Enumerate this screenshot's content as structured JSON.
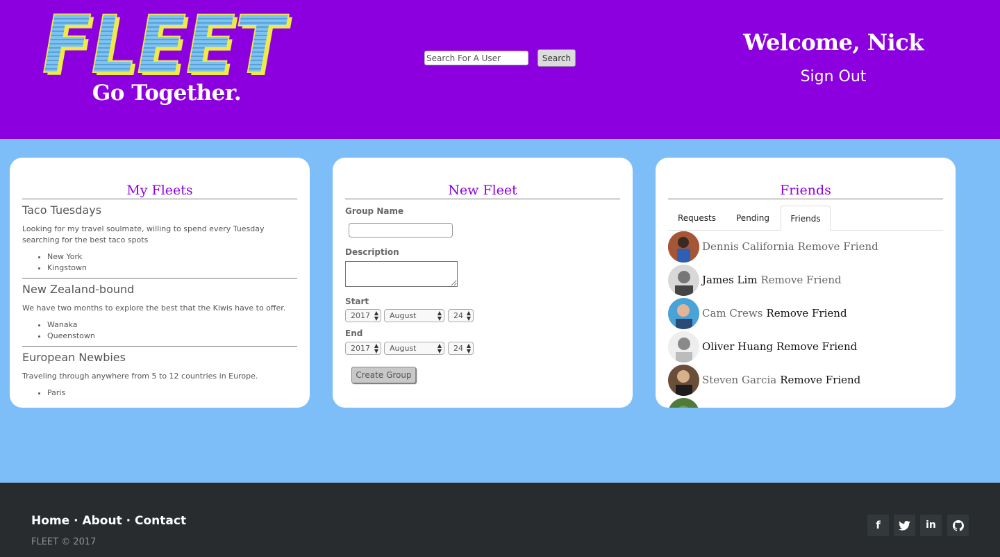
{
  "header": {
    "logo_text": "FLEET",
    "tagline": "Go Together.",
    "search": {
      "placeholder": "Search For A User",
      "button_label": "Search"
    },
    "welcome": "Welcome, Nick",
    "sign_out": "Sign Out"
  },
  "my_fleets": {
    "title": "My Fleets",
    "items": [
      {
        "name": "Taco Tuesdays",
        "description": "Looking for my travel soulmate, willing to spend every Tuesday searching for the best taco spots",
        "cities": [
          "New York",
          "Kingstown"
        ]
      },
      {
        "name": "New Zealand-bound",
        "description": "We have two months to explore the best that the Kiwis have to offer.",
        "cities": [
          "Wanaka",
          "Queenstown"
        ]
      },
      {
        "name": "European Newbies",
        "description": "Traveling through anywhere from 5 to 12 countries in Europe.",
        "cities": [
          "Paris"
        ]
      }
    ]
  },
  "new_fleet": {
    "title": "New Fleet",
    "group_name_label": "Group Name",
    "description_label": "Description",
    "start_label": "Start",
    "end_label": "End",
    "start": {
      "year": "2017",
      "month": "August",
      "day": "24"
    },
    "end": {
      "year": "2017",
      "month": "August",
      "day": "24"
    },
    "create_button": "Create Group"
  },
  "friends": {
    "title": "Friends",
    "tabs": [
      {
        "label": "Requests",
        "active": false
      },
      {
        "label": "Pending",
        "active": false
      },
      {
        "label": "Friends",
        "active": true
      }
    ],
    "list": [
      {
        "name": "Dennis California",
        "action": "Remove Friend"
      },
      {
        "name": "James Lim",
        "action": "Remove Friend"
      },
      {
        "name": "Cam Crews",
        "action": "Remove Friend"
      },
      {
        "name": "Oliver Huang",
        "action": "Remove Friend"
      },
      {
        "name": "Steven Garcia",
        "action": "Remove Friend"
      }
    ]
  },
  "footer": {
    "links": [
      "Home",
      "About",
      "Contact"
    ],
    "separator": "·",
    "copyright": "FLEET © 2017",
    "social_icons": [
      "facebook-icon",
      "twitter-icon",
      "linkedin-icon",
      "github-icon"
    ]
  },
  "colors": {
    "header_bg": "#8c00e0",
    "page_bg": "#7dbef8",
    "footer_bg": "#292c2f",
    "accent": "#8c00e0"
  }
}
